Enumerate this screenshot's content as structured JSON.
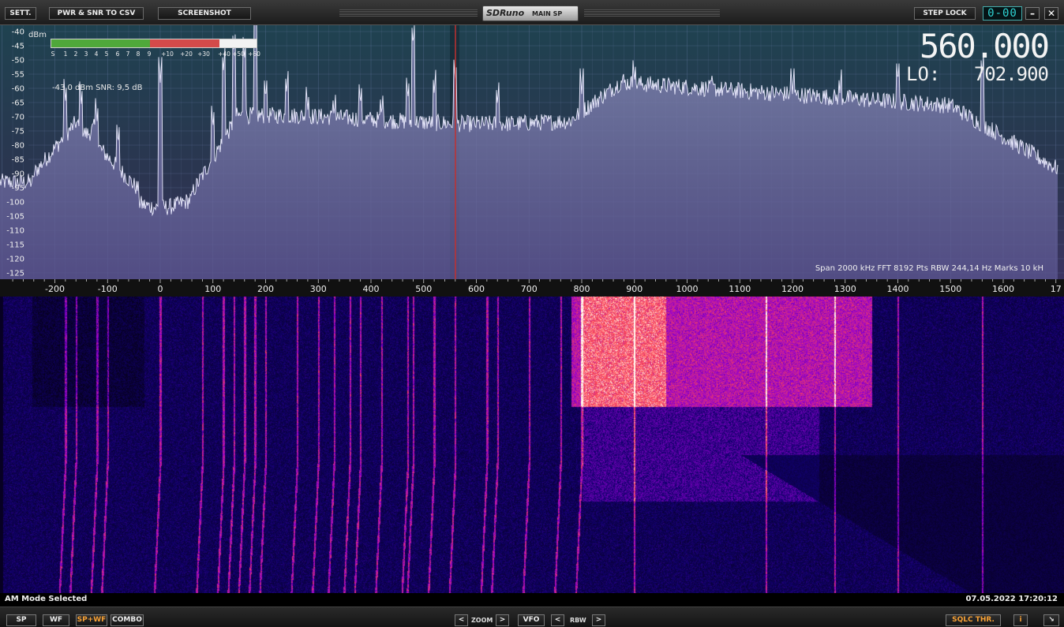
{
  "toolbar": {
    "settings_label": "SETT.",
    "pwr_csv_label": "PWR & SNR TO CSV",
    "screenshot_label": "SCREENSHOT",
    "app_logo": "SDRuno",
    "app_window": "MAIN SP",
    "step_lock_label": "STEP LOCK",
    "step_digits": "0-00",
    "minimize_label": "–",
    "close_label": "✕"
  },
  "spectrum": {
    "unit": "dBm",
    "db_ticks": [
      "-40",
      "-45",
      "-50",
      "-55",
      "-60",
      "-65",
      "-70",
      "-75",
      "-80",
      "-85",
      "-90",
      "-95",
      "-100",
      "-105",
      "-110",
      "-115",
      "-120",
      "-125"
    ],
    "freq_ticks": [
      "-200",
      "-100",
      "0",
      "100",
      "200",
      "300",
      "400",
      "500",
      "600",
      "700",
      "800",
      "900",
      "1000",
      "1100",
      "1200",
      "1300",
      "1400",
      "1500",
      "1600",
      "17"
    ],
    "level_readout": "-43,0 dBm   SNR: 9,5 dB",
    "smeter_scale": [
      "S",
      "1",
      "2",
      "3",
      "4",
      "5",
      "6",
      "7",
      "8",
      "9",
      "+10",
      "+20",
      "+30",
      "+40",
      "+50",
      "+60"
    ],
    "smeter_green_fraction": 0.48,
    "smeter_red_fraction": 0.82,
    "tuned_freq": "560.000",
    "lo_label": "LO:",
    "lo_freq": "702.900",
    "span_info": "Span 2000 kHz   FFT 8192 Pts   RBW 244,14 Hz   Marks 10 kH"
  },
  "status": {
    "mode": "AM Mode Selected",
    "datetime": "07.05.2022 17:20:12"
  },
  "bottom": {
    "sp_label": "SP",
    "wf_label": "WF",
    "spwf_label": "SP+WF",
    "combo_label": "COMBO",
    "zoom_label": "ZOOM",
    "vfo_label": "VFO",
    "rbw_label": "RBW",
    "prev_label": "<",
    "next_label": ">",
    "sqlc_label": "SQLC THR.",
    "info_label": "i",
    "resize_label": "↘"
  },
  "colors": {
    "spectrum_bg": "#1d3a46",
    "trace": "#e9e9ff",
    "tuned_marker": "#c03030",
    "active_button": "#f7a136"
  }
}
